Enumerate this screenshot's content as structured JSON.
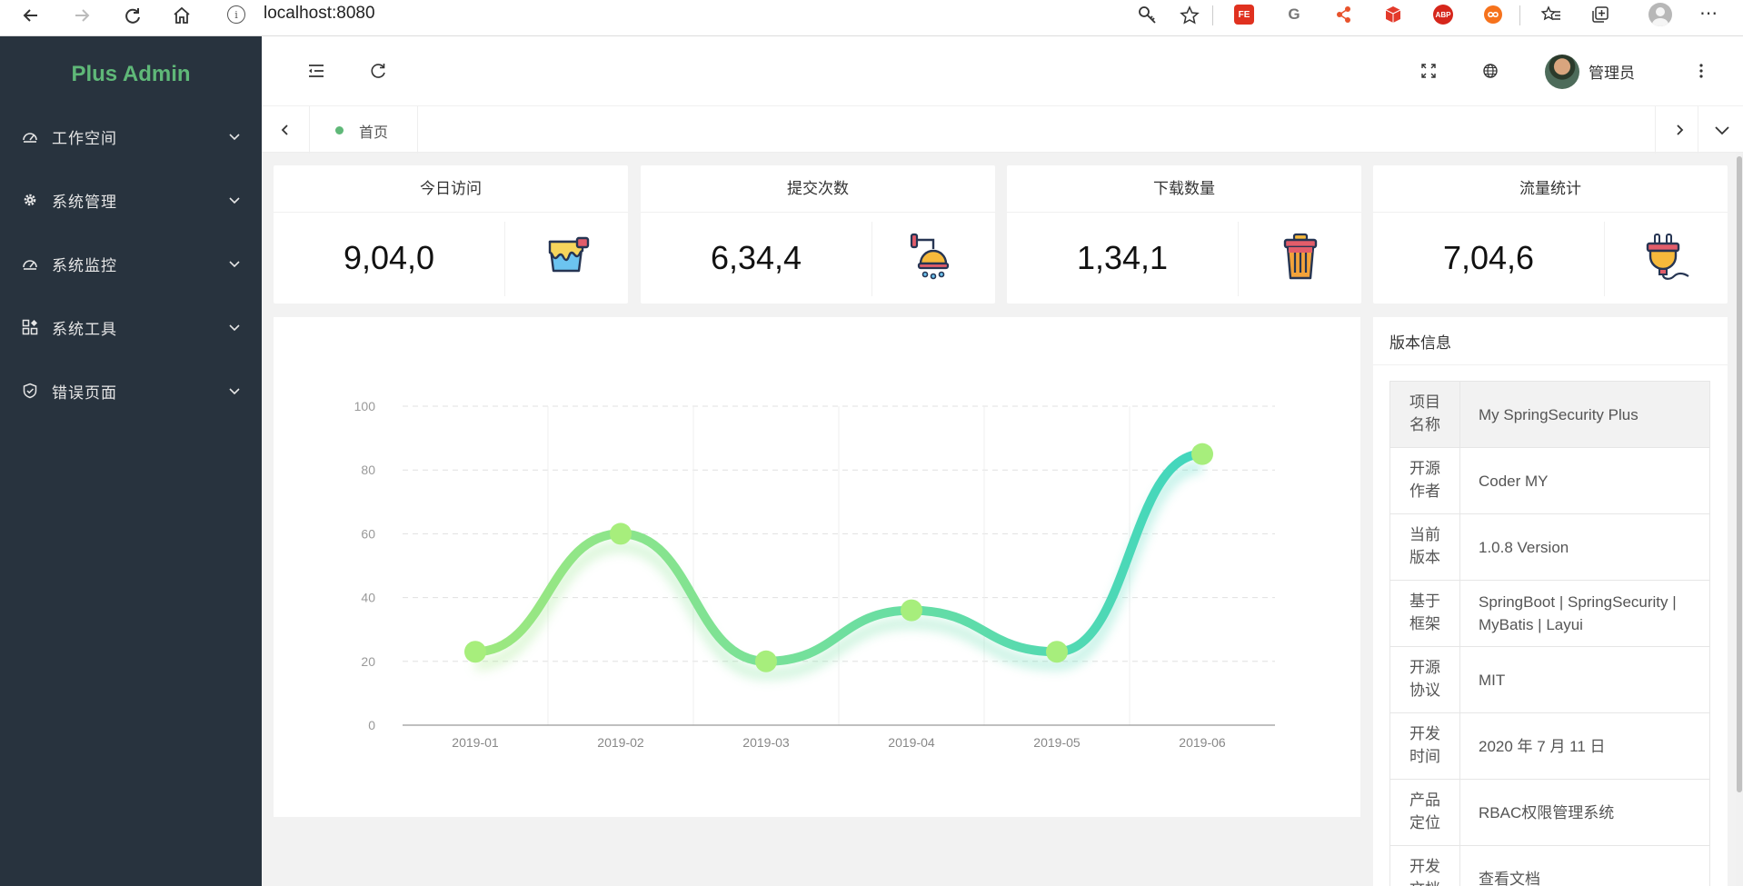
{
  "browser": {
    "url": "localhost:8080",
    "info_icon": "i",
    "extensions": [
      "FE",
      "G",
      "ABP"
    ]
  },
  "sidebar": {
    "logo": "Plus Admin",
    "items": [
      {
        "label": "工作空间",
        "icon": "dashboard-icon"
      },
      {
        "label": "系统管理",
        "icon": "gear-icon"
      },
      {
        "label": "系统监控",
        "icon": "dashboard-icon"
      },
      {
        "label": "系统工具",
        "icon": "grid-icon"
      },
      {
        "label": "错误页面",
        "icon": "shield-icon"
      }
    ]
  },
  "header": {
    "user_name": "管理员"
  },
  "tabs": {
    "home_label": "首页"
  },
  "cards": [
    {
      "title": "今日访问",
      "value": "9,04,0",
      "icon": "paint-bucket-icon"
    },
    {
      "title": "提交次数",
      "value": "6,34,4",
      "icon": "shower-icon"
    },
    {
      "title": "下载数量",
      "value": "1,34,1",
      "icon": "trash-can-icon"
    },
    {
      "title": "流量统计",
      "value": "7,04,6",
      "icon": "plug-icon"
    }
  ],
  "chart_data": {
    "type": "line",
    "smooth": true,
    "categories": [
      "2019-01",
      "2019-02",
      "2019-03",
      "2019-04",
      "2019-05",
      "2019-06"
    ],
    "series": [
      {
        "values": [
          23,
          60,
          20,
          36,
          23,
          85
        ]
      }
    ],
    "ylim": [
      0,
      100
    ],
    "yticks": [
      0,
      20,
      40,
      60,
      80,
      100
    ],
    "grid": true,
    "colors": {
      "start": "#9ee87e",
      "end": "#41d6be",
      "point": "#a7ee7c"
    }
  },
  "version": {
    "title": "版本信息",
    "rows": [
      {
        "key": "项目名称",
        "value": "My SpringSecurity Plus"
      },
      {
        "key": "开源作者",
        "value": "Coder MY"
      },
      {
        "key": "当前版本",
        "value": "1.0.8 Version"
      },
      {
        "key": "基于框架",
        "value": "SpringBoot | SpringSecurity | MyBatis | Layui"
      },
      {
        "key": "开源协议",
        "value": "MIT"
      },
      {
        "key": "开发时间",
        "value": "2020 年 7 月 11 日"
      },
      {
        "key": "产品定位",
        "value": "RBAC权限管理系统"
      },
      {
        "key": "开发文档",
        "value": "查看文档"
      }
    ]
  }
}
